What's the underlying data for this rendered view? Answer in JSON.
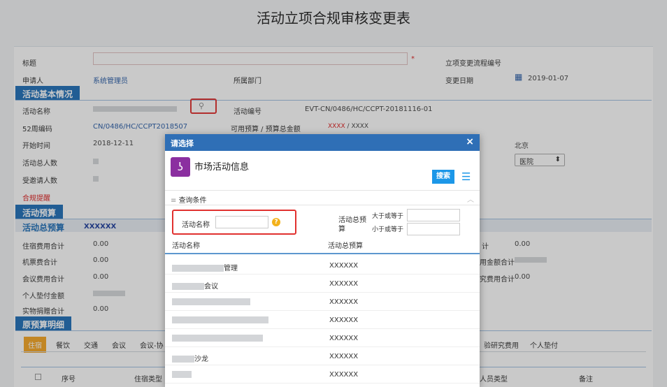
{
  "page": {
    "title": "活动立项合规审核变更表"
  },
  "form": {
    "title_label": "标题",
    "required_mark": "*",
    "change_flow_no_label": "立项变更流程编号",
    "applicant_label": "申请人",
    "applicant_value": "系统管理员",
    "department_label": "所属部门",
    "change_date_label": "变更日期",
    "change_date_value": "2019-01-07",
    "sec_basic": "活动基本情况",
    "activity_name_label": "活动名称",
    "activity_no_label": "活动编号",
    "activity_no_value": "EVT-CN/0486/HC/CCPT-20181116-01",
    "week52_label": "52周编码",
    "week52_value": "CN/0486/HC/CCPT2018507",
    "budget_label": "可用预算 / 预算总金额",
    "budget_value": "XXXX",
    "budget_sep": " / ",
    "budget_total": "XXXX",
    "start_time_label": "开始时间",
    "start_time_value": "2018-12-11",
    "city_value": "北京",
    "total_people_label": "活动总人数",
    "hospital_select": "医院",
    "invited_label": "受邀请人数",
    "compliance_label": "合规提醒",
    "sec_budget": "活动预算",
    "total_budget_label": "活动总预算",
    "total_budget_value": "XXXXXX",
    "lodging_total_label": "住宿费用合计",
    "lodging_total_value": "0.00",
    "ticket_total_label": "机票费合计",
    "ticket_total_value": "0.00",
    "meeting_total_label": "会议费用合计",
    "meeting_total_value": "0.00",
    "personal_advance_label": "个人垫付金额",
    "gift_total_label": "实物捐赠合计",
    "gift_total_value": "0.00",
    "right_total_suffix": "计",
    "right_total_value": "0.00",
    "right_amount_suffix": "用金额合计",
    "right_research_suffix": "究费用合计",
    "right_research_value": "0.00",
    "sec_original": "原预算明细",
    "tabs": [
      "住宿",
      "餐饮",
      "交通",
      "会议",
      "会议-协",
      "验研究费用",
      "个人垫付"
    ],
    "table_headers": {
      "seq": "序号",
      "lodging_type": "住宿类型",
      "person_type": "人员类型",
      "remark": "备注"
    }
  },
  "dialog": {
    "title": "请选择",
    "close": "×",
    "app_title": "市场活动信息",
    "search_button": "搜索",
    "query_label": "查询条件",
    "query_chevron": "︿",
    "name_label": "活动名称",
    "help": "?",
    "budget_label_line1": "活动总预",
    "budget_label_line2": "算",
    "gte_label": "大于或等于",
    "lte_label": "小于或等于",
    "col_name": "活动名称",
    "col_budget": "活动总预算",
    "rows": [
      {
        "suffix": "管理",
        "amount": "XXXXXX"
      },
      {
        "suffix": "会议",
        "amount": "XXXXXX"
      },
      {
        "suffix": "",
        "amount": "XXXXXX"
      },
      {
        "suffix": "",
        "amount": "XXXXXX"
      },
      {
        "suffix": "",
        "amount": "XXXXXX"
      },
      {
        "suffix": "沙龙",
        "amount": "XXXXXX"
      },
      {
        "suffix": "",
        "amount": "XXXXXX"
      }
    ]
  },
  "icons": {
    "calendar": "calendar-icon",
    "search": "search-icon",
    "menu": "list-icon",
    "app": "activity-app-icon"
  },
  "colors": {
    "section_blue": "#1f6fb8",
    "dialog_header": "#2f6fb6",
    "search_button": "#1c97e8",
    "tab_active": "#f6a623",
    "highlight": "#e1312f",
    "app_icon": "#8b2fa0"
  }
}
